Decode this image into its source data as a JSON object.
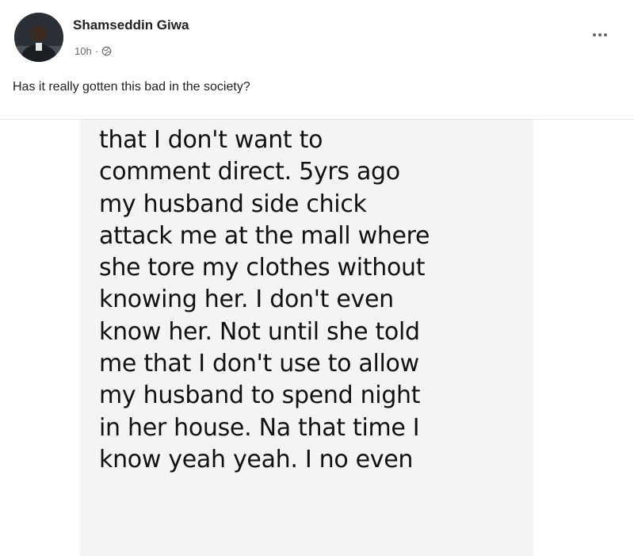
{
  "post": {
    "author_name": "Shamseddin Giwa",
    "time_ago": "10h",
    "separator": "·",
    "audience_icon": "globe-icon",
    "more_icon": "more-options-icon",
    "caption": "Has it really gotten this bad in the society?"
  },
  "shared_image": {
    "lines": [
      "that I don't want to",
      "comment direct. 5yrs ago",
      "my husband side chick",
      "attack me at the mall where",
      "she tore my clothes without",
      "knowing her. I don't even",
      "know her. Not until she told",
      "me that I don't use to allow",
      "my husband to spend night",
      "in her house. Na that time I",
      "know yeah yeah. I no even"
    ]
  },
  "colors": {
    "text_primary": "#1f1f1f",
    "text_secondary": "#65676b",
    "image_background": "#f4f4f2"
  }
}
